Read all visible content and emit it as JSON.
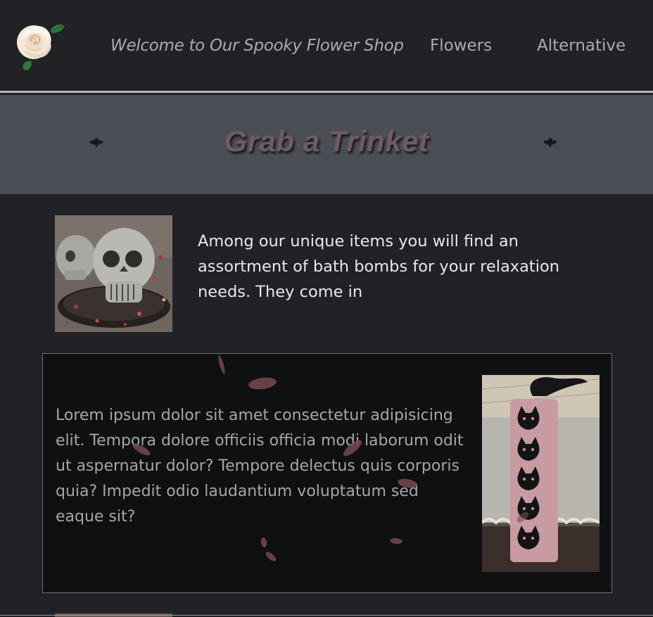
{
  "header": {
    "logo_icon": "white-rose-icon",
    "welcome_text": "Welcome to Our Spooky Flower Shop",
    "nav": [
      {
        "label": "Flowers"
      },
      {
        "label": "Alternative"
      }
    ]
  },
  "banner": {
    "title": "Grab a Trinket",
    "left_icon": "bat-icon",
    "right_icon": "bat-icon"
  },
  "items": [
    {
      "image": "skull-bath-bombs",
      "description": "Among our unique items you will find an assortment of bath bombs for your relaxation needs. They come in"
    }
  ],
  "feature": {
    "text": "Lorem ipsum dolor sit amet consectetur adipisicing elit. Tempora dolore officiis officia modi laborum odit ut aspernatur dolor? Tempore delectus quis corporis quia? Impedit odio laudantium voluptatum sed eaque sit?",
    "image": "cat-bookmark"
  },
  "colors": {
    "background": "#202226",
    "banner": "#4b4f55",
    "feature_bg": "#0f1012",
    "petal": "#7a4a50",
    "nav_text": "#a9acaf",
    "title": "#6f5c62"
  }
}
